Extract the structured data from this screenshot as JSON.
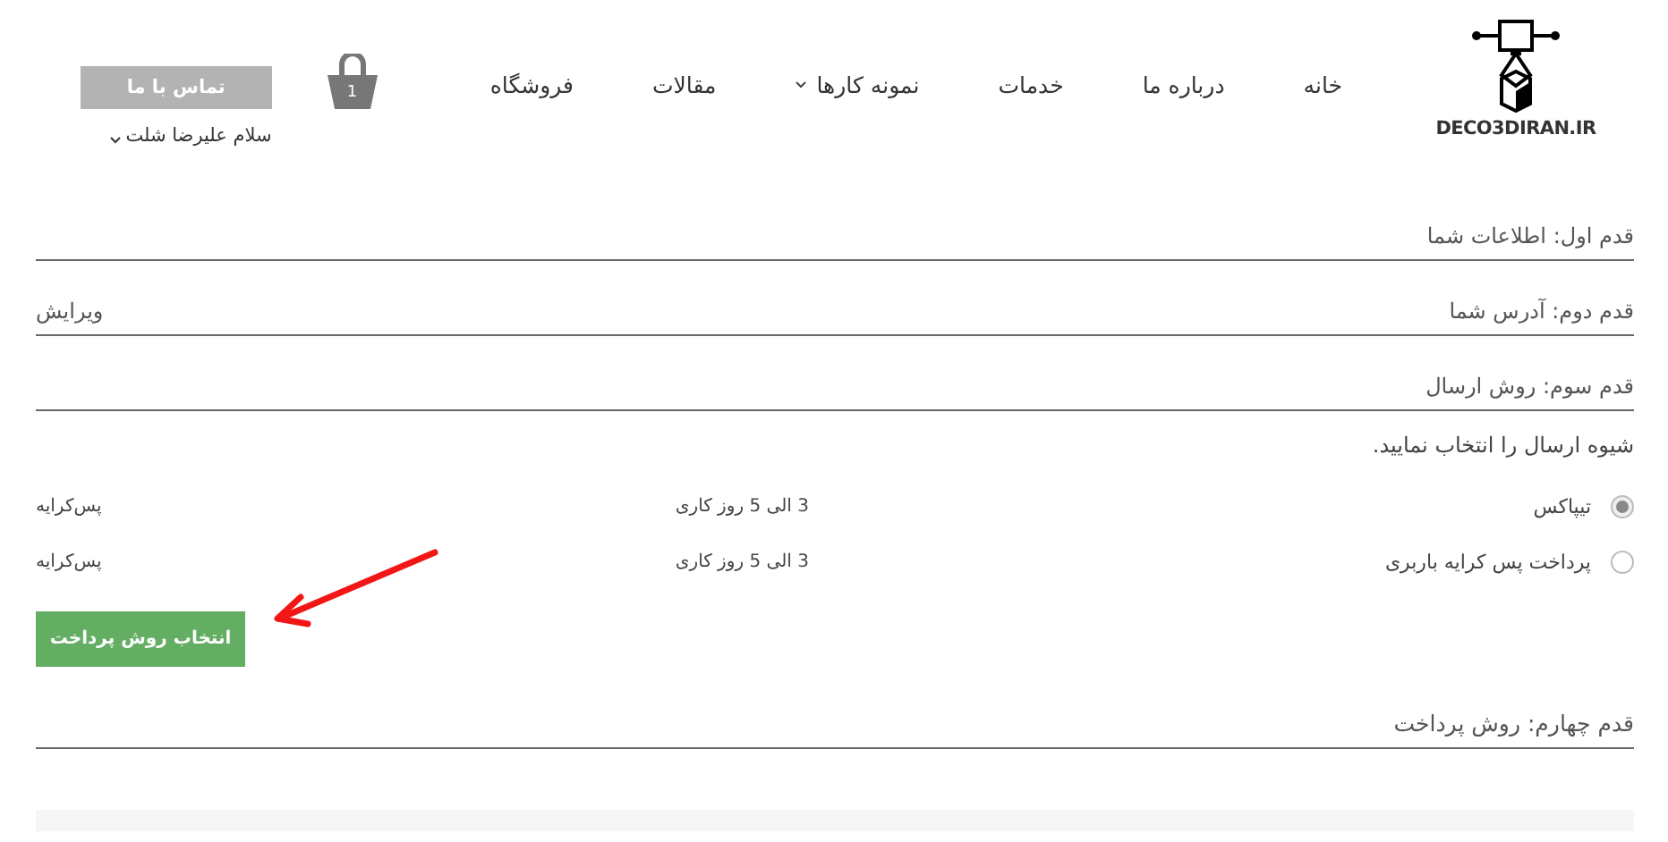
{
  "header": {
    "logo_text": "DECO3DIRAN.IR",
    "nav": [
      {
        "label": "خانه",
        "has_menu": false
      },
      {
        "label": "درباره ما",
        "has_menu": false
      },
      {
        "label": "خدمات",
        "has_menu": false
      },
      {
        "label": "نمونه کارها",
        "has_menu": true
      },
      {
        "label": "مقالات",
        "has_menu": false
      },
      {
        "label": "فروشگاه",
        "has_menu": false
      }
    ],
    "cart_count": "1",
    "contact_button": "تماس با ما",
    "greeting": "سلام علیرضا شلت"
  },
  "steps": [
    {
      "title": "قدم اول: اطلاعات شما"
    },
    {
      "title": "قدم دوم: آدرس شما",
      "action": "ویرایش"
    },
    {
      "title": "قدم سوم: روش ارسال"
    }
  ],
  "shipping": {
    "prompt": "شیوه ارسال را انتخاب نمایید.",
    "options": [
      {
        "name": "تیپاکس",
        "time": "3 الی 5 روز کاری",
        "cost": "پس‌کرایه",
        "selected": true
      },
      {
        "name": "پرداخت پس کرایه باربری",
        "time": "3 الی 5 روز کاری",
        "cost": "پس‌کرایه",
        "selected": false
      }
    ],
    "submit_button": "انتخاب روش پرداخت"
  },
  "final_step": {
    "title": "قدم چهارم: روش پرداخت"
  }
}
